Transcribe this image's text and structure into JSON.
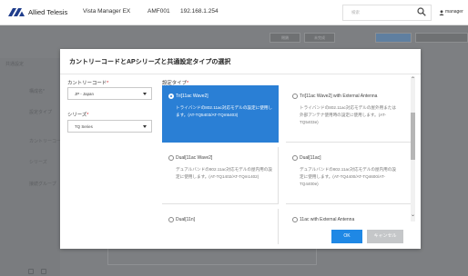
{
  "header": {
    "brand": "Allied Telesis",
    "app_title": "Vista Manager EX",
    "device": "AMF001",
    "ip": "192.168.1.254",
    "search_placeholder": "検索",
    "user": "manager"
  },
  "background": {
    "toolbar_buttons": [
      "閉鎖",
      "未完成",
      "",
      ""
    ],
    "left_items": [
      "共通設定",
      "構成名*",
      "設定タイプ",
      "カントリーコード",
      "シリーズ",
      "接続グループ"
    ]
  },
  "modal": {
    "title": "カントリーコードとAPシリーズと共通設定タイプの選択",
    "country": {
      "label": "カントリーコード",
      "required": "*",
      "value": "JP - Japan"
    },
    "series": {
      "label": "シリーズ",
      "required": "*",
      "value": "TQ Series"
    },
    "config_type": {
      "label": "設定タイプ",
      "required": "*"
    },
    "options": [
      {
        "title": "Tri[11ac Wave2]",
        "desc": "トライバンドの802.11ac対応モデルの設定に使用します。(AT-TQ5403/AT-TQm5403)",
        "selected": true
      },
      {
        "title": "Tri[11ac Wave2] with External Antenna",
        "desc": "トライバンドの802.11ac対応モデルの屋外用または外部アンテナ使用時の設定に使用します。(AT-TQ5403e)",
        "selected": false
      },
      {
        "title": "Dual[11ac Wave2]",
        "desc": "デュアルバンドの802.11ac対応モデルの屋内用の設定に使用します。(AT-TQ1402/AT-TQm1402)",
        "selected": false
      },
      {
        "title": "Dual[11ac]",
        "desc": "デュアルバンドの802.11ac対応モデルの屋内用の設定に使用します。(AT-TQ4400/AT-TQ4600/AT-TQ4400e)",
        "selected": false
      },
      {
        "title": "Dual[11n]",
        "desc": "",
        "selected": false
      },
      {
        "title": "11ac with External Antenna",
        "desc": "",
        "selected": false
      }
    ],
    "ok_label": "OK",
    "cancel_label": "キャンセル"
  },
  "colors": {
    "accent": "#2a7fd5",
    "ok_button": "#1f88e5",
    "required": "#d9272e"
  }
}
